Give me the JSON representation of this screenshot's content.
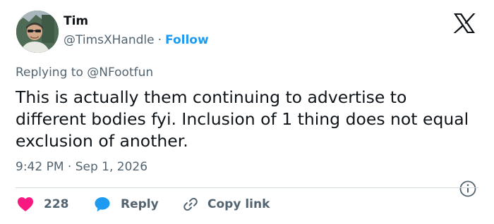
{
  "author": {
    "name": "Tim",
    "handle": "@TimsXHandle",
    "separator": "·",
    "follow_label": "Follow"
  },
  "reply_context": {
    "prefix": "Replying to",
    "target": "@NFootfun"
  },
  "tweet": {
    "text": "This is actually them continuing to advertise to different bodies fyi. Inclusion of 1 thing does not equal exclusion of another.",
    "time": "9:42 PM",
    "separator": "·",
    "date": "Sep 1, 2026"
  },
  "actions": {
    "likes_count": "228",
    "reply_label": "Reply",
    "copy_link_label": "Copy link"
  },
  "colors": {
    "accent": "#1d9bf0",
    "like": "#f91880",
    "secondary_text": "#536471",
    "divider": "#cfd9de"
  },
  "icons": {
    "brand": "x-logo-icon",
    "info": "info-icon",
    "like": "heart-icon",
    "reply": "speech-bubble-icon",
    "copy": "link-icon"
  }
}
